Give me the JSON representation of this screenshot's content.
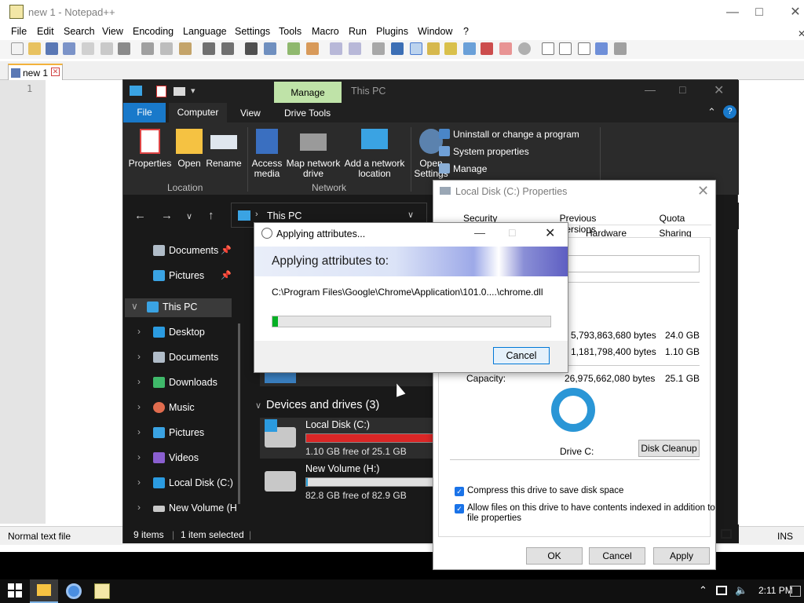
{
  "notepad": {
    "title": "new 1 - Notepad++",
    "menu": [
      "File",
      "Edit",
      "Search",
      "View",
      "Encoding",
      "Language",
      "Settings",
      "Tools",
      "Macro",
      "Run",
      "Plugins",
      "Window",
      "?"
    ],
    "tab": "new 1",
    "line_number": "1",
    "status_left": "Normal text file",
    "status_right": "INS"
  },
  "explorer": {
    "context_tab": "Manage",
    "title": "This PC",
    "tabs": {
      "file": "File",
      "computer": "Computer",
      "view": "View",
      "drive_tools": "Drive Tools"
    },
    "ribbon": {
      "properties": "Properties",
      "open": "Open",
      "rename": "Rename",
      "access_media": "Access media",
      "map_drive": "Map network drive",
      "add_location": "Add a network location",
      "open_settings": "Open Settings",
      "uninstall": "Uninstall or change a program",
      "system_properties": "System properties",
      "manage": "Manage",
      "group_location": "Location",
      "group_network": "Network"
    },
    "address": "This PC",
    "sidebar": {
      "documents_quick": "Documents",
      "pictures_quick": "Pictures",
      "this_pc": "This PC",
      "desktop": "Desktop",
      "documents": "Documents",
      "downloads": "Downloads",
      "music": "Music",
      "pictures": "Pictures",
      "videos": "Videos",
      "local_disk": "Local Disk (C:)",
      "new_volume": "New Volume (H"
    },
    "devices_header": "Devices and drives (3)",
    "drives": [
      {
        "name": "Local Disk (C:)",
        "free": "1.10 GB free of 25.1 GB",
        "used_fraction": 0.956,
        "bar_color": "#da2626"
      },
      {
        "name": "New Volume (H:)",
        "free": "82.8 GB free of 82.9 GB",
        "used_fraction": 0.01,
        "bar_color": "#26a0da"
      }
    ],
    "status": {
      "items": "9 items",
      "selected": "1 item selected"
    }
  },
  "properties": {
    "title": "Local Disk (C:) Properties",
    "tabs_row1": [
      "Security",
      "Previous Versions",
      "Quota"
    ],
    "tabs_row2": [
      "Hardware",
      "Sharing"
    ],
    "used_bytes": "5,793,863,680 bytes",
    "used_gb": "24.0 GB",
    "free_bytes": "1,181,798,400 bytes",
    "free_gb": "1.10 GB",
    "capacity_label": "Capacity:",
    "capacity_bytes": "26,975,662,080 bytes",
    "capacity_gb": "25.1 GB",
    "drive_label": "Drive C:",
    "disk_cleanup": "Disk Cleanup",
    "compress_label": "Compress this drive to save disk space",
    "index_label_1": "Allow files on this drive to have contents indexed in addition to",
    "index_label_2": "file properties",
    "ok": "OK",
    "cancel": "Cancel",
    "apply": "Apply"
  },
  "applying": {
    "title": "Applying attributes...",
    "heading": "Applying attributes to:",
    "path": "C:\\Program Files\\Google\\Chrome\\Application\\101.0....\\chrome.dll",
    "progress": 0.02,
    "cancel": "Cancel"
  },
  "taskbar": {
    "clock": "2:11 PM"
  }
}
